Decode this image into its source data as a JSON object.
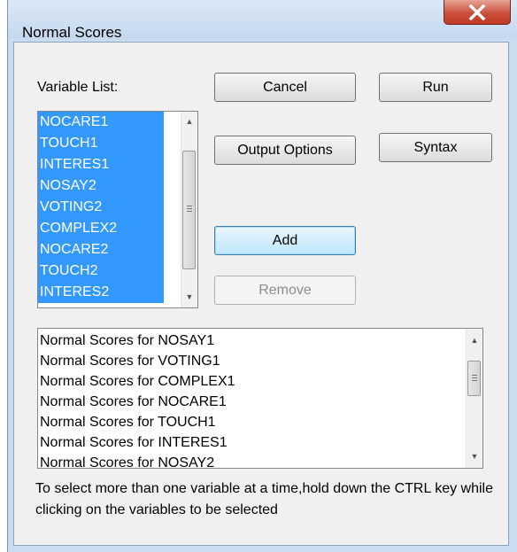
{
  "window": {
    "title": "Normal Scores",
    "close_icon": "close-icon"
  },
  "variable_list": {
    "label": "Variable List:",
    "items": [
      "NOCARE1",
      "TOUCH1",
      "INTERES1",
      "NOSAY2",
      "VOTING2",
      "COMPLEX2",
      "NOCARE2",
      "TOUCH2",
      "INTERES2"
    ]
  },
  "buttons": {
    "cancel": "Cancel",
    "run": "Run",
    "output_options": "Output Options",
    "syntax": "Syntax",
    "add": "Add",
    "remove": "Remove"
  },
  "output_list": {
    "items": [
      "Normal Scores for NOSAY1",
      "Normal Scores for VOTING1",
      "Normal Scores for COMPLEX1",
      "Normal Scores for NOCARE1",
      "Normal Scores for TOUCH1",
      "Normal Scores for INTERES1",
      "Normal Scores for NOSAY2"
    ]
  },
  "hint": "To select more than one variable at a time,hold down the CTRL key while clicking on the variables to be selected",
  "colors": {
    "selection": "#3399ff",
    "close_button": "#c9503b",
    "dialog_bg": "#f0f0f0"
  }
}
